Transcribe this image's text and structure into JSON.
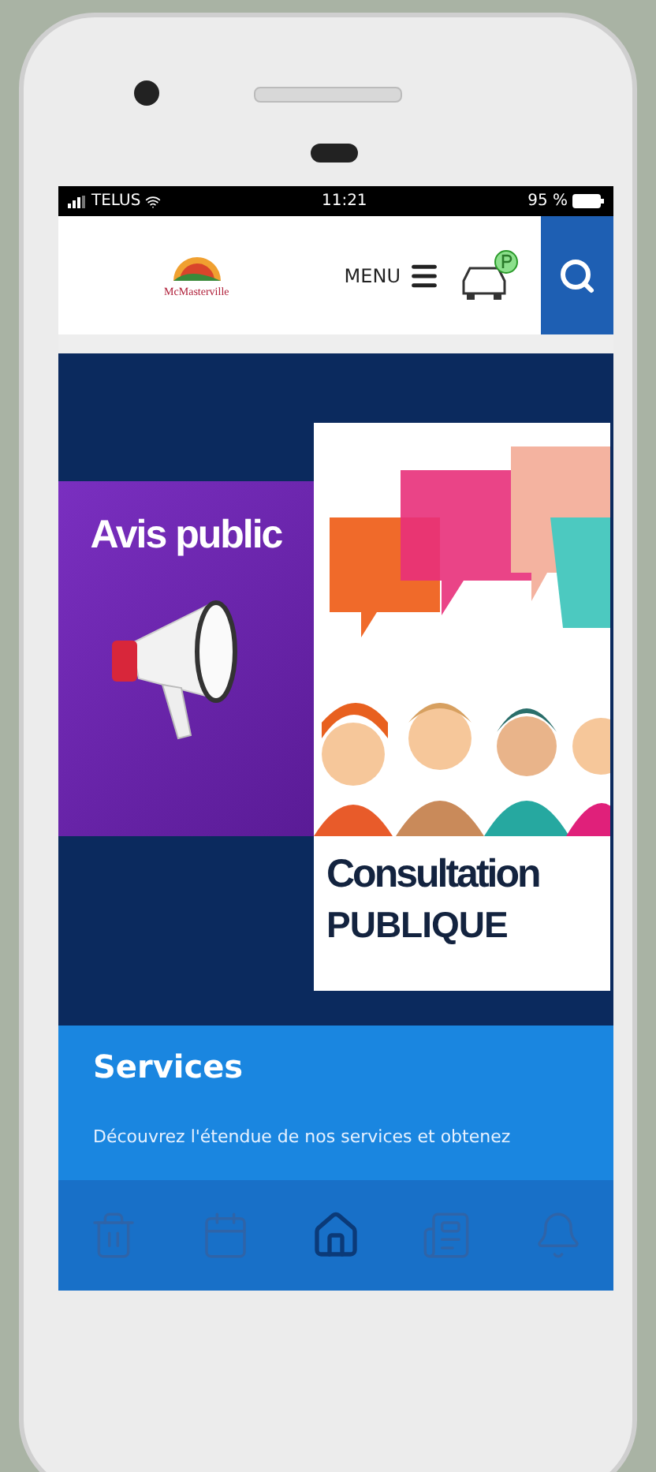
{
  "status_bar": {
    "carrier": "TELUS",
    "time": "11:21",
    "battery": "95 %"
  },
  "header": {
    "logo_text": "McMasterville",
    "menu_label": "MENU"
  },
  "banners": [
    {
      "kind": "notice",
      "title": "Avis public"
    },
    {
      "kind": "consultation",
      "title": "Consultation",
      "subtitle": "PUBLIQUE"
    }
  ],
  "services": {
    "title": "Services",
    "text": "Découvrez l'étendue de nos services et obtenez"
  },
  "bottom_nav": [
    {
      "kind": "trash",
      "selected": false
    },
    {
      "kind": "calendar",
      "selected": false
    },
    {
      "kind": "home",
      "selected": true
    },
    {
      "kind": "news",
      "selected": false
    },
    {
      "kind": "bell",
      "selected": false
    }
  ]
}
